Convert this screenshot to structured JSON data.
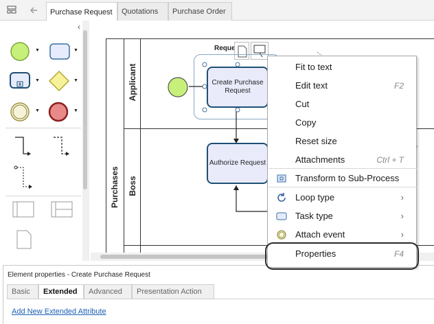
{
  "tabs": [
    {
      "label": "Purchase Request",
      "active": true
    },
    {
      "label": "Quotations",
      "active": false
    },
    {
      "label": "Purchase Order",
      "active": false
    }
  ],
  "diagram": {
    "pool_name": "Purchases",
    "lanes": [
      "Applicant",
      "Boss"
    ],
    "tasks": {
      "create": "Create Purchase Request",
      "authorize": "Authorize Request"
    },
    "partial_label": "Reque",
    "partial_right_label": "e"
  },
  "context_menu": {
    "items": [
      {
        "label": "Fit to text",
        "shortcut": "",
        "submenu": false,
        "icon": ""
      },
      {
        "label": "Edit text",
        "shortcut": "F2",
        "submenu": false,
        "icon": ""
      },
      {
        "label": "Cut",
        "shortcut": "",
        "submenu": false,
        "icon": ""
      },
      {
        "label": "Copy",
        "shortcut": "",
        "submenu": false,
        "icon": ""
      },
      {
        "label": "Reset size",
        "shortcut": "",
        "submenu": false,
        "icon": ""
      },
      {
        "label": "Attachments",
        "shortcut": "Ctrl + T",
        "submenu": false,
        "icon": ""
      },
      {
        "label": "Transform to Sub-Process",
        "shortcut": "",
        "submenu": false,
        "icon": "subprocess-icon"
      },
      {
        "label": "Loop type",
        "shortcut": "",
        "submenu": true,
        "icon": "loop-icon"
      },
      {
        "label": "Task type",
        "shortcut": "",
        "submenu": true,
        "icon": "task-icon"
      },
      {
        "label": "Attach event",
        "shortcut": "",
        "submenu": true,
        "icon": "event-icon"
      },
      {
        "label": "Properties",
        "shortcut": "F4",
        "submenu": false,
        "icon": ""
      }
    ]
  },
  "properties_panel": {
    "title": "Element properties - Create Purchase Request",
    "tabs": [
      {
        "label": "Basic",
        "active": false
      },
      {
        "label": "Extended",
        "active": true
      },
      {
        "label": "Advanced",
        "active": false
      },
      {
        "label": "Presentation Action",
        "active": false
      }
    ],
    "link": "Add New Extended Attribute"
  },
  "colors": {
    "start_event": "#c6f07a",
    "task_fill": "#e9ebfb",
    "task_border": "#1e4f75",
    "end_event": "#e88a8a",
    "gateway": "#f7f29a",
    "link": "#1a5fb4"
  }
}
